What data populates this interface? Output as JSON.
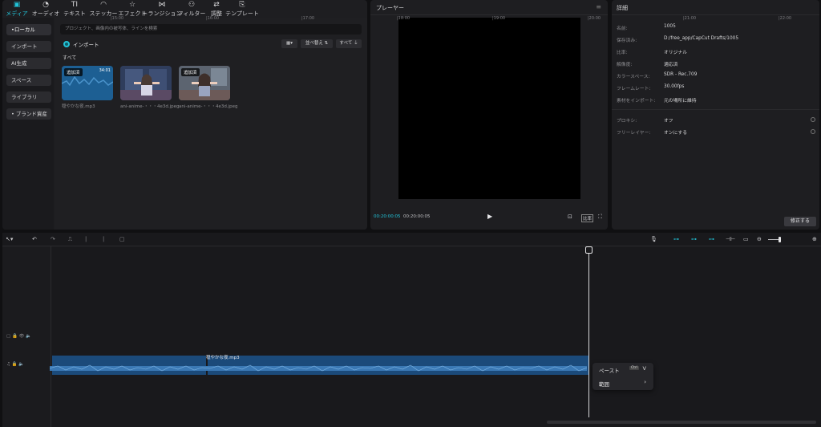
{
  "colors": {
    "accent": "#22c3d8",
    "clip": "#1b4a7a",
    "waveform": "#3a78b4"
  },
  "media_tabs": [
    {
      "icon": "media-icon",
      "glyph": "▣",
      "label": "メディア"
    },
    {
      "icon": "audio-icon",
      "glyph": "◔",
      "label": "オーディオ"
    },
    {
      "icon": "text-icon",
      "glyph": "TI",
      "label": "テキスト"
    },
    {
      "icon": "sticker-icon",
      "glyph": "◠",
      "label": "ステッカー"
    },
    {
      "icon": "effect-icon",
      "glyph": "☆",
      "label": "エフェクト"
    },
    {
      "icon": "transition-icon",
      "glyph": "⋈",
      "label": "トランジション"
    },
    {
      "icon": "filter-icon",
      "glyph": "⚇",
      "label": "フィルター"
    },
    {
      "icon": "adjust-icon",
      "glyph": "⇄",
      "label": "調整"
    },
    {
      "icon": "template-icon",
      "glyph": "⎘",
      "label": "テンプレート"
    }
  ],
  "sidebar": [
    "•ローカル",
    "インポート",
    "AI生成",
    "スペース",
    "ライブラリ",
    "• ブランド資産"
  ],
  "search": {
    "placeholder": "プロジェクト、画像内の被写体、ラインを検索"
  },
  "import_label": "インポート",
  "view_menu": "▦▾",
  "sort_label": "並べ替え ⇅",
  "filter_label": "すべて ⏚",
  "section_all": "すべて",
  "media_items": [
    {
      "badge": "追加済",
      "duration": "34:01",
      "name": "穏やかな夜.mp3"
    },
    {
      "badge": "",
      "duration": "",
      "name": "ani-anime-・・・4e3d.jpeg"
    },
    {
      "badge": "追加済",
      "duration": "",
      "name": "ani-anime-・・・4e3d.jpeg"
    }
  ],
  "player": {
    "title": "プレーヤー",
    "menu_icon": "≡",
    "current": "00:20:00:05",
    "total": "00:20:00:05",
    "play": "▶",
    "fit_icon": "⊡",
    "ratio_label": "比率",
    "fullscreen_icon": "⛶"
  },
  "details": {
    "title": "詳細",
    "rows": [
      {
        "label": "名前:",
        "value": "1005"
      },
      {
        "label": "保存済み:",
        "value": "D:/free_app/CapCut Drafts/1005"
      },
      {
        "label": "比率:",
        "value": "オリジナル"
      },
      {
        "label": "解像度:",
        "value": "適応済"
      },
      {
        "label": "カラースペース:",
        "value": "SDR - Rec.709"
      },
      {
        "label": "フレームレート:",
        "value": "30.00fps"
      },
      {
        "label": "素材をインポート:",
        "value": "元の場所に維持"
      }
    ],
    "rows2": [
      {
        "label": "プロキシ:",
        "value": "オフ"
      },
      {
        "label": "フリーレイヤー:",
        "value": "オンにする"
      }
    ],
    "modify_label": "修正する"
  },
  "timeline": {
    "tools": [
      "↖▾",
      "↶",
      "↷",
      "⎍",
      "⎸",
      "⎸",
      "▢"
    ],
    "right_tools": [
      {
        "icon": "mic-icon",
        "glyph": "🎙"
      },
      {
        "icon": "link-icon",
        "glyph": "⊶"
      },
      {
        "icon": "magnet-icon",
        "glyph": "⊶"
      },
      {
        "icon": "link2-icon",
        "glyph": "⊶"
      },
      {
        "icon": "split-icon",
        "glyph": "⊣⊢"
      },
      {
        "icon": "preview-icon",
        "glyph": "▭"
      },
      {
        "icon": "zoom-out-icon",
        "glyph": "⊖"
      }
    ],
    "zoom_in": "⊕",
    "ruler_ticks": [
      "|15:00",
      "|16:00",
      "|17:00",
      "|18:00",
      "|19:00",
      "|20:00",
      "|21:00",
      "|22:00"
    ],
    "track_icons": [
      "▢ 🔒 👁 🔈",
      "♫ 🔒 🔈"
    ],
    "clip_label": "穏やかな夜.mp3"
  },
  "context_menu": {
    "paste": "ペースト",
    "paste_key": "Ctrl",
    "paste_key2": "V",
    "range": "範囲",
    "chevron": "›"
  }
}
